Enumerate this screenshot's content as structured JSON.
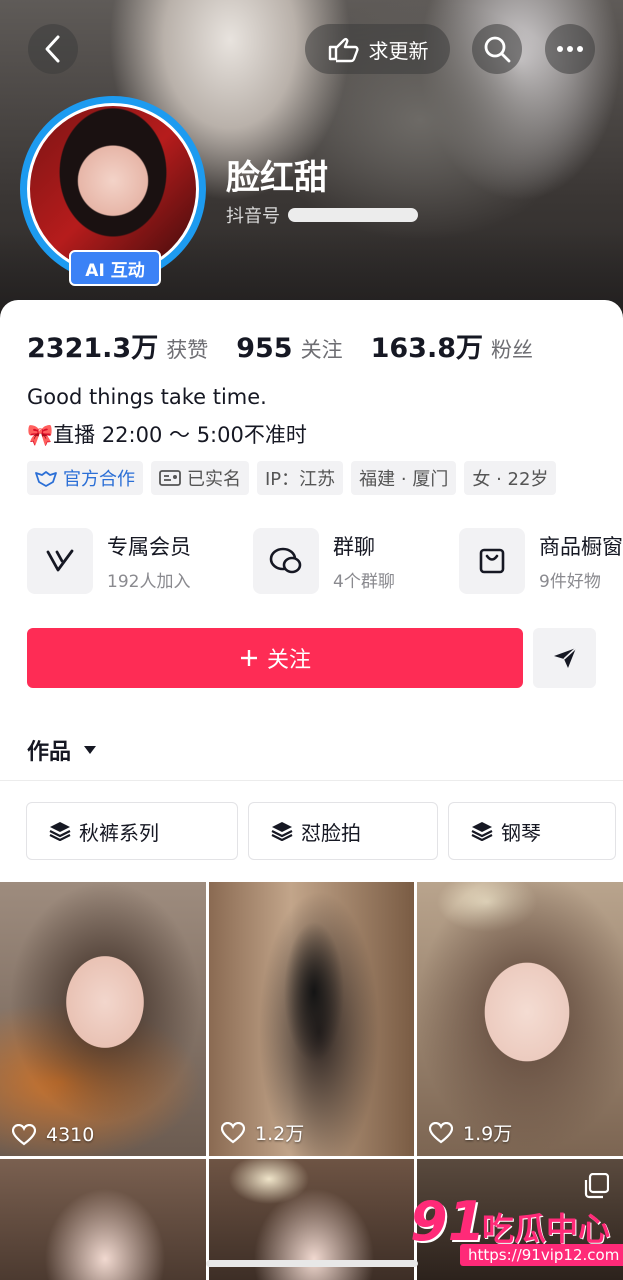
{
  "header": {
    "update_label": "求更新",
    "nickname": "脸红甜",
    "douyin_id_label": "抖音号",
    "ai_badge": "AI 互动"
  },
  "stats": [
    {
      "value": "2321.3万",
      "label": "获赞"
    },
    {
      "value": "955",
      "label": "关注"
    },
    {
      "value": "163.8万",
      "label": "粉丝"
    }
  ],
  "bio": {
    "line1": "Good things take time.",
    "line2": "🎀直播 22:00 ～ 5:00不准时"
  },
  "tags": {
    "official": "官方合作",
    "verified": "已实名",
    "ip": "IP：江苏",
    "city": "福建 · 厦门",
    "gender_age": "女 · 22岁"
  },
  "services": [
    {
      "title": "专属会员",
      "sub": "192人加入",
      "icon": "vip-icon"
    },
    {
      "title": "群聊",
      "sub": "4个群聊",
      "icon": "chat-icon"
    },
    {
      "title": "商品橱窗",
      "sub": "9件好物",
      "icon": "shop-bag-icon"
    }
  ],
  "actions": {
    "follow": "关注"
  },
  "works_tab": "作品",
  "collections": [
    "秋裤系列",
    "怼脸拍",
    "钢琴"
  ],
  "videos": [
    {
      "likes": "4310"
    },
    {
      "likes": "1.2万"
    },
    {
      "likes": "1.9万"
    }
  ],
  "watermark": {
    "big": "91",
    "cn": "吃瓜中心",
    "url": "https://91vip12.com"
  },
  "colors": {
    "accent": "#fe2c55",
    "ai_badge": "#3b82f6",
    "avatar_ring": "#1d9bf0"
  }
}
